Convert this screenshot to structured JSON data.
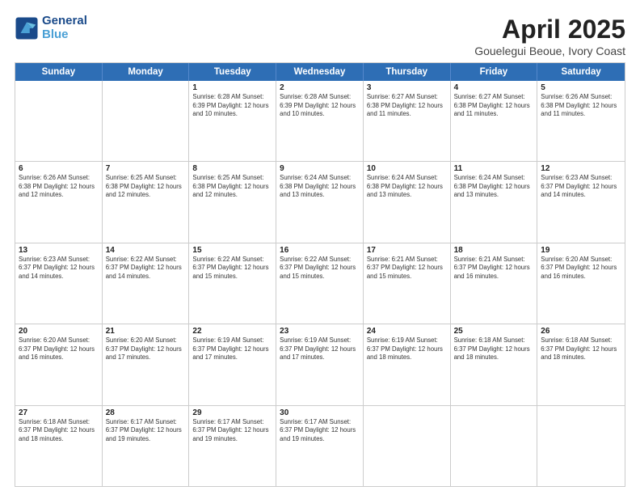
{
  "header": {
    "logo_line1": "General",
    "logo_line2": "Blue",
    "title": "April 2025",
    "subtitle": "Gouelegui Beoue, Ivory Coast"
  },
  "calendar": {
    "days": [
      "Sunday",
      "Monday",
      "Tuesday",
      "Wednesday",
      "Thursday",
      "Friday",
      "Saturday"
    ],
    "rows": [
      [
        {
          "day": "",
          "info": ""
        },
        {
          "day": "",
          "info": ""
        },
        {
          "day": "1",
          "info": "Sunrise: 6:28 AM\nSunset: 6:39 PM\nDaylight: 12 hours and 10 minutes."
        },
        {
          "day": "2",
          "info": "Sunrise: 6:28 AM\nSunset: 6:39 PM\nDaylight: 12 hours and 10 minutes."
        },
        {
          "day": "3",
          "info": "Sunrise: 6:27 AM\nSunset: 6:38 PM\nDaylight: 12 hours and 11 minutes."
        },
        {
          "day": "4",
          "info": "Sunrise: 6:27 AM\nSunset: 6:38 PM\nDaylight: 12 hours and 11 minutes."
        },
        {
          "day": "5",
          "info": "Sunrise: 6:26 AM\nSunset: 6:38 PM\nDaylight: 12 hours and 11 minutes."
        }
      ],
      [
        {
          "day": "6",
          "info": "Sunrise: 6:26 AM\nSunset: 6:38 PM\nDaylight: 12 hours and 12 minutes."
        },
        {
          "day": "7",
          "info": "Sunrise: 6:25 AM\nSunset: 6:38 PM\nDaylight: 12 hours and 12 minutes."
        },
        {
          "day": "8",
          "info": "Sunrise: 6:25 AM\nSunset: 6:38 PM\nDaylight: 12 hours and 12 minutes."
        },
        {
          "day": "9",
          "info": "Sunrise: 6:24 AM\nSunset: 6:38 PM\nDaylight: 12 hours and 13 minutes."
        },
        {
          "day": "10",
          "info": "Sunrise: 6:24 AM\nSunset: 6:38 PM\nDaylight: 12 hours and 13 minutes."
        },
        {
          "day": "11",
          "info": "Sunrise: 6:24 AM\nSunset: 6:38 PM\nDaylight: 12 hours and 13 minutes."
        },
        {
          "day": "12",
          "info": "Sunrise: 6:23 AM\nSunset: 6:37 PM\nDaylight: 12 hours and 14 minutes."
        }
      ],
      [
        {
          "day": "13",
          "info": "Sunrise: 6:23 AM\nSunset: 6:37 PM\nDaylight: 12 hours and 14 minutes."
        },
        {
          "day": "14",
          "info": "Sunrise: 6:22 AM\nSunset: 6:37 PM\nDaylight: 12 hours and 14 minutes."
        },
        {
          "day": "15",
          "info": "Sunrise: 6:22 AM\nSunset: 6:37 PM\nDaylight: 12 hours and 15 minutes."
        },
        {
          "day": "16",
          "info": "Sunrise: 6:22 AM\nSunset: 6:37 PM\nDaylight: 12 hours and 15 minutes."
        },
        {
          "day": "17",
          "info": "Sunrise: 6:21 AM\nSunset: 6:37 PM\nDaylight: 12 hours and 15 minutes."
        },
        {
          "day": "18",
          "info": "Sunrise: 6:21 AM\nSunset: 6:37 PM\nDaylight: 12 hours and 16 minutes."
        },
        {
          "day": "19",
          "info": "Sunrise: 6:20 AM\nSunset: 6:37 PM\nDaylight: 12 hours and 16 minutes."
        }
      ],
      [
        {
          "day": "20",
          "info": "Sunrise: 6:20 AM\nSunset: 6:37 PM\nDaylight: 12 hours and 16 minutes."
        },
        {
          "day": "21",
          "info": "Sunrise: 6:20 AM\nSunset: 6:37 PM\nDaylight: 12 hours and 17 minutes."
        },
        {
          "day": "22",
          "info": "Sunrise: 6:19 AM\nSunset: 6:37 PM\nDaylight: 12 hours and 17 minutes."
        },
        {
          "day": "23",
          "info": "Sunrise: 6:19 AM\nSunset: 6:37 PM\nDaylight: 12 hours and 17 minutes."
        },
        {
          "day": "24",
          "info": "Sunrise: 6:19 AM\nSunset: 6:37 PM\nDaylight: 12 hours and 18 minutes."
        },
        {
          "day": "25",
          "info": "Sunrise: 6:18 AM\nSunset: 6:37 PM\nDaylight: 12 hours and 18 minutes."
        },
        {
          "day": "26",
          "info": "Sunrise: 6:18 AM\nSunset: 6:37 PM\nDaylight: 12 hours and 18 minutes."
        }
      ],
      [
        {
          "day": "27",
          "info": "Sunrise: 6:18 AM\nSunset: 6:37 PM\nDaylight: 12 hours and 18 minutes."
        },
        {
          "day": "28",
          "info": "Sunrise: 6:17 AM\nSunset: 6:37 PM\nDaylight: 12 hours and 19 minutes."
        },
        {
          "day": "29",
          "info": "Sunrise: 6:17 AM\nSunset: 6:37 PM\nDaylight: 12 hours and 19 minutes."
        },
        {
          "day": "30",
          "info": "Sunrise: 6:17 AM\nSunset: 6:37 PM\nDaylight: 12 hours and 19 minutes."
        },
        {
          "day": "",
          "info": ""
        },
        {
          "day": "",
          "info": ""
        },
        {
          "day": "",
          "info": ""
        }
      ]
    ]
  }
}
